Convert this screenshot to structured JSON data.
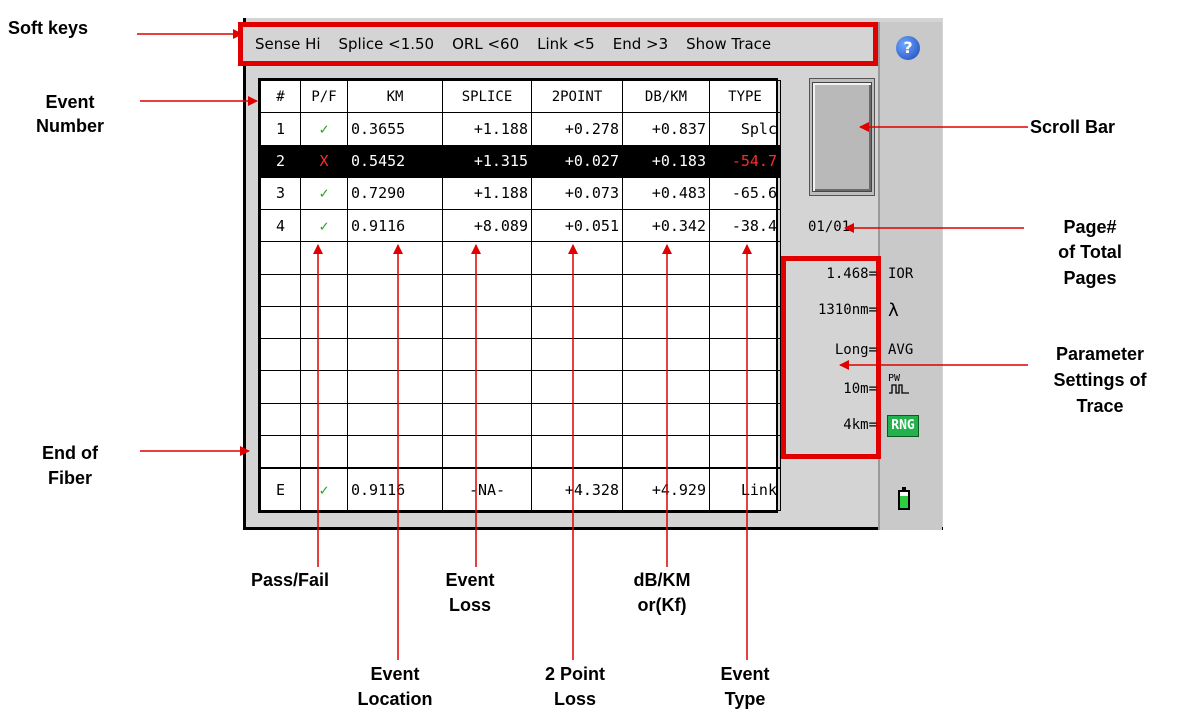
{
  "softkeys": [
    "Sense Hi",
    "Splice <1.50",
    "ORL <60",
    "Link <5",
    "End >3",
    "Show Trace"
  ],
  "help_icon": "?",
  "table": {
    "headers": [
      "#",
      "P/F",
      "KM",
      "SPLICE",
      "2POINT",
      "DB/KM",
      "TYPE"
    ],
    "rows": [
      {
        "num": "1",
        "pf": "✓",
        "km": "0.3655",
        "splice": "+1.188",
        "point2": "+0.278",
        "dbkm": "+0.837",
        "type": "Splc"
      },
      {
        "num": "2",
        "pf": "X",
        "km": "0.5452",
        "splice": "+1.315",
        "point2": "+0.027",
        "dbkm": "+0.183",
        "type": "-54.7"
      },
      {
        "num": "3",
        "pf": "✓",
        "km": "0.7290",
        "splice": "+1.188",
        "point2": "+0.073",
        "dbkm": "+0.483",
        "type": "-65.6"
      },
      {
        "num": "4",
        "pf": "✓",
        "km": "0.9116",
        "splice": "+8.089",
        "point2": "+0.051",
        "dbkm": "+0.342",
        "type": "-38.4"
      }
    ],
    "end_row": {
      "num": "E",
      "pf": "✓",
      "km": "0.9116",
      "splice": "-NA-",
      "point2": "+4.328",
      "dbkm": "+4.929",
      "type": "Link"
    }
  },
  "page_indicator": "01/01",
  "parameters": {
    "ior": {
      "value": "1.468=",
      "icon_label": "IOR"
    },
    "wavelength": {
      "value": "1310nm=",
      "icon_label": "λ"
    },
    "averaging": {
      "value": "Long=",
      "icon_label": "AVG"
    },
    "pulse_width": {
      "value": "10m=",
      "icon_label": "PW"
    },
    "range": {
      "value": "4km=",
      "icon_label": "RNG"
    }
  },
  "callouts": {
    "soft_keys": "Soft keys",
    "event_number_1": "Event",
    "event_number_2": "Number",
    "scroll_bar": "Scroll Bar",
    "page_1": "Page#",
    "page_2": "of Total",
    "page_3": "Pages",
    "param_1": "Parameter",
    "param_2": "Settings of",
    "param_3": "Trace",
    "end_1": "End of",
    "end_2": "Fiber",
    "pass_fail": "Pass/Fail",
    "event_loss_1": "Event",
    "event_loss_2": "Loss",
    "dbkm_1": "dB/KM",
    "dbkm_2": "or(Kf)",
    "location_1": "Event",
    "location_2": "Location",
    "two_point_1": "2 Point",
    "two_point_2": "Loss",
    "type_1": "Event",
    "type_2": "Type"
  },
  "colors": {
    "highlight": "#e00000",
    "pass": "#1faa1f",
    "fail": "#ff2a2a",
    "rng": "#22b14c"
  }
}
